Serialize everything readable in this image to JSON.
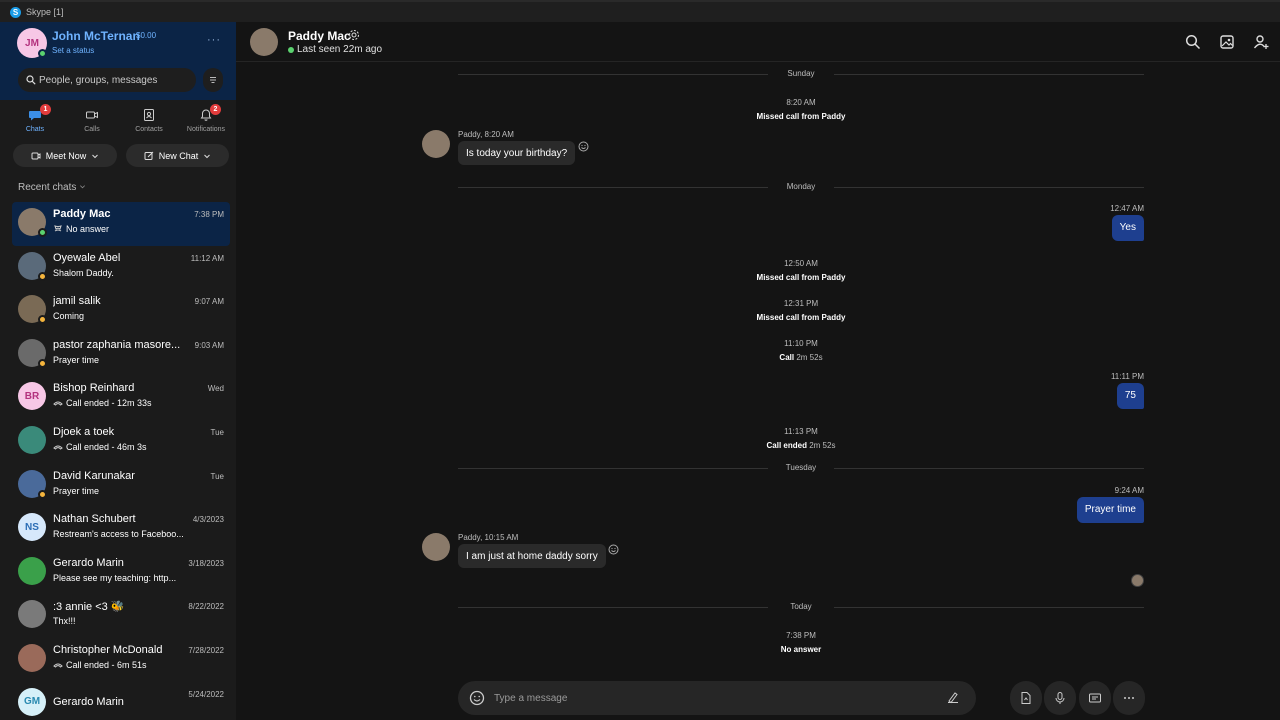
{
  "window": {
    "title": "Skype [1]",
    "logo_letter": "S"
  },
  "profile": {
    "initials": "JM",
    "name": "John McTernan",
    "balance": "$0.00",
    "status": "Set a status",
    "more": "···"
  },
  "search": {
    "placeholder": "People, groups, messages"
  },
  "nav": {
    "chats": "Chats",
    "chats_badge": "1",
    "calls": "Calls",
    "contacts": "Contacts",
    "notifications": "Notifications",
    "notifications_badge": "2"
  },
  "actions": {
    "meet_now": "Meet Now",
    "new_chat": "New Chat"
  },
  "recent": {
    "label": "Recent chats"
  },
  "chats": [
    {
      "name": "Paddy Mac",
      "time": "7:38 PM",
      "preview": "No answer",
      "initials": "",
      "avatar_color": "#8a7a6a",
      "status": "online",
      "icon": "missed-call"
    },
    {
      "name": "Oyewale Abel",
      "time": "11:12 AM",
      "preview": "Shalom Daddy.",
      "initials": "",
      "avatar_color": "#5a6a7a",
      "status": "away",
      "icon": ""
    },
    {
      "name": "jamil salik",
      "time": "9:07 AM",
      "preview": "Coming",
      "initials": "",
      "avatar_color": "#7a6a55",
      "status": "away",
      "icon": ""
    },
    {
      "name": "pastor zaphania  masore...",
      "time": "9:03 AM",
      "preview": "Prayer time",
      "initials": "",
      "avatar_color": "#6a6a6a",
      "status": "away",
      "icon": ""
    },
    {
      "name": "Bishop Reinhard",
      "time": "Wed",
      "preview": "Call ended - 12m 33s",
      "initials": "BR",
      "avatar_color": "#f7c7e6",
      "status": "",
      "icon": "call"
    },
    {
      "name": "Djoek a toek",
      "time": "Tue",
      "preview": "Call ended - 46m 3s",
      "initials": "",
      "avatar_color": "#3a8a7a",
      "status": "",
      "icon": "call"
    },
    {
      "name": "David Karunakar",
      "time": "Tue",
      "preview": "Prayer time",
      "initials": "",
      "avatar_color": "#4a6a9a",
      "status": "away",
      "icon": ""
    },
    {
      "name": "Nathan Schubert",
      "time": "4/3/2023",
      "preview": "Restream's access to Faceboo...",
      "initials": "NS",
      "avatar_color": "#d6e8fb",
      "status": "",
      "icon": ""
    },
    {
      "name": "Gerardo Marin",
      "time": "3/18/2023",
      "preview": "Please see my teaching: http...",
      "initials": "",
      "avatar_color": "#3aa04a",
      "status": "",
      "icon": ""
    },
    {
      "name": ":3 annie <3 🐝",
      "time": "8/22/2022",
      "preview": "Thx!!!",
      "initials": "",
      "avatar_color": "#7a7a7a",
      "status": "",
      "icon": ""
    },
    {
      "name": "Christopher McDonald",
      "time": "7/28/2022",
      "preview": "Call ended - 6m 51s",
      "initials": "",
      "avatar_color": "#9a6a5a",
      "status": "",
      "icon": "call"
    },
    {
      "name": "Gerardo Marin",
      "time": "5/24/2022",
      "preview": "",
      "initials": "GM",
      "avatar_color": "#d6f0f8",
      "status": "",
      "icon": ""
    }
  ],
  "conversation": {
    "name": "Paddy Mac",
    "last_seen": "Last seen 22m ago",
    "days": {
      "sunday": "Sunday",
      "monday": "Monday",
      "tuesday": "Tuesday",
      "today": "Today"
    },
    "events": {
      "e1_time": "8:20 AM",
      "e1_text": "Missed call from Paddy",
      "e2_time": "12:50 AM",
      "e2_text": "Missed call from Paddy",
      "e3_time": "12:31 PM",
      "e3_text": "Missed call from Paddy",
      "e4_time": "11:10 PM",
      "e4_bold": "Call",
      "e4_dur": "2m 52s",
      "e5_time": "11:13 PM",
      "e5_bold": "Call ended",
      "e5_dur": "2m 52s",
      "e6_time": "7:38 PM",
      "e6_text": "No answer"
    },
    "incoming": [
      {
        "meta": "Paddy, 8:20 AM",
        "text": "Is today your birthday?"
      },
      {
        "meta": "Paddy, 10:15 AM",
        "text": "I am just at home daddy sorry"
      }
    ],
    "outgoing": [
      {
        "time": "12:47 AM",
        "text": "Yes"
      },
      {
        "time": "11:11 PM",
        "text": "75"
      },
      {
        "time": "9:24 AM",
        "text": "Prayer time"
      }
    ]
  },
  "composer": {
    "placeholder": "Type a message"
  },
  "colors": {
    "accent": "#6fb3ff",
    "bubble_out": "#1e3f8f",
    "online": "#5bd26f",
    "away": "#f5b53d",
    "badge": "#e23c3c"
  }
}
